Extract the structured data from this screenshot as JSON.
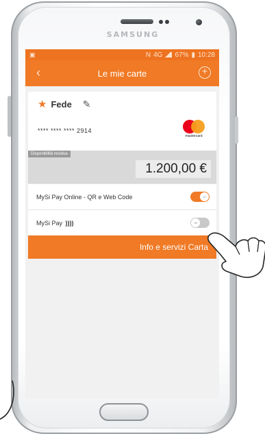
{
  "device": {
    "brand": "SAMSUNG"
  },
  "status_bar": {
    "signal": "4G",
    "battery": "67%",
    "time": "10:28"
  },
  "app_bar": {
    "back_icon": "chevron-left-icon",
    "title": "Le mie carte",
    "add_icon": "plus-circle-icon"
  },
  "card": {
    "name": "Fede",
    "number": "**** **** **** 2914",
    "network": "mastercard",
    "available_label": "Disponibilità residua",
    "available_amount": "1.200,00 €"
  },
  "rows": [
    {
      "label": "MySi Pay Online - QR e Web Code",
      "toggle_text": "on",
      "state": "on"
    },
    {
      "label": "MySi Pay",
      "nfc_symbol": "))))",
      "toggle_text": "off",
      "state": "off"
    }
  ],
  "actions": {
    "info_button": "Info e servizi Carta"
  },
  "colors": {
    "accent": "#f07a25",
    "status_bar": "#ee7320",
    "mastercard_red": "#eb001b",
    "mastercard_yellow": "#f79e1b"
  }
}
